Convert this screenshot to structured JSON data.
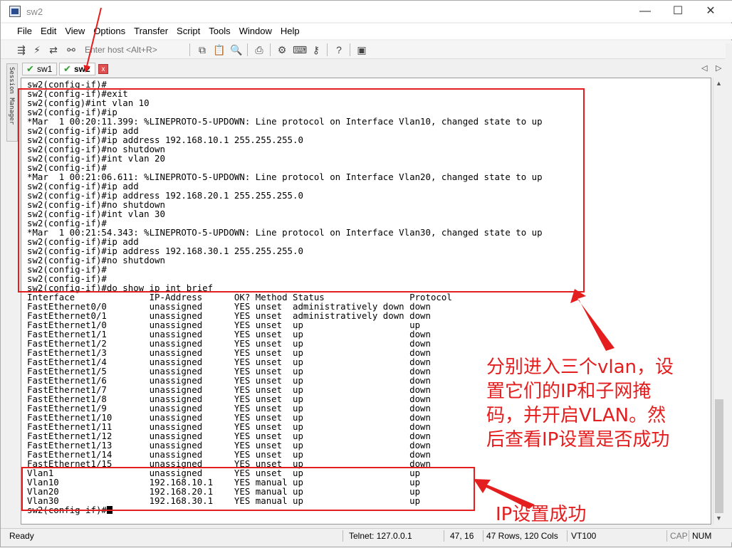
{
  "window": {
    "title": "sw2",
    "controls": {
      "minimize": "—",
      "maximize": "☐",
      "close": "✕"
    }
  },
  "menu": [
    "File",
    "Edit",
    "View",
    "Options",
    "Transfer",
    "Script",
    "Tools",
    "Window",
    "Help"
  ],
  "toolbar": {
    "host_placeholder": "Enter host <Alt+R>"
  },
  "session_manager": {
    "label": "Session Manager"
  },
  "tabs": [
    {
      "label": "sw1",
      "status": "connected"
    },
    {
      "label": "sw2",
      "status": "connected",
      "active": true
    }
  ],
  "terminal": {
    "lines": [
      "sw2(config-if)#",
      "sw2(config-if)#exit",
      "sw2(config)#int vlan 10",
      "sw2(config-if)#ip",
      "*Mar  1 00:20:11.399: %LINEPROTO-5-UPDOWN: Line protocol on Interface Vlan10, changed state to up",
      "sw2(config-if)#ip add",
      "sw2(config-if)#ip address 192.168.10.1 255.255.255.0",
      "sw2(config-if)#no shutdown",
      "sw2(config-if)#int vlan 20",
      "sw2(config-if)#",
      "*Mar  1 00:21:06.611: %LINEPROTO-5-UPDOWN: Line protocol on Interface Vlan20, changed state to up",
      "sw2(config-if)#ip add",
      "sw2(config-if)#ip address 192.168.20.1 255.255.255.0",
      "sw2(config-if)#no shutdown",
      "sw2(config-if)#int vlan 30",
      "sw2(config-if)#",
      "*Mar  1 00:21:54.343: %LINEPROTO-5-UPDOWN: Line protocol on Interface Vlan30, changed state to up",
      "sw2(config-if)#ip add",
      "sw2(config-if)#ip address 192.168.30.1 255.255.255.0",
      "sw2(config-if)#no shutdown",
      "sw2(config-if)#",
      "sw2(config-if)#",
      "sw2(config-if)#do show ip int brief",
      "Interface              IP-Address      OK? Method Status                Protocol",
      "FastEthernet0/0        unassigned      YES unset  administratively down down",
      "FastEthernet0/1        unassigned      YES unset  administratively down down",
      "FastEthernet1/0        unassigned      YES unset  up                    up",
      "FastEthernet1/1        unassigned      YES unset  up                    down",
      "FastEthernet1/2        unassigned      YES unset  up                    down",
      "FastEthernet1/3        unassigned      YES unset  up                    down",
      "FastEthernet1/4        unassigned      YES unset  up                    down",
      "FastEthernet1/5        unassigned      YES unset  up                    down",
      "FastEthernet1/6        unassigned      YES unset  up                    down",
      "FastEthernet1/7        unassigned      YES unset  up                    down",
      "FastEthernet1/8        unassigned      YES unset  up                    down",
      "FastEthernet1/9        unassigned      YES unset  up                    down",
      "FastEthernet1/10       unassigned      YES unset  up                    down",
      "FastEthernet1/11       unassigned      YES unset  up                    down",
      "FastEthernet1/12       unassigned      YES unset  up                    down",
      "FastEthernet1/13       unassigned      YES unset  up                    down",
      "FastEthernet1/14       unassigned      YES unset  up                    down",
      "FastEthernet1/15       unassigned      YES unset  up                    down",
      "Vlan1                  unassigned      YES unset  up                    up",
      "Vlan10                 192.168.10.1    YES manual up                    up",
      "Vlan20                 192.168.20.1    YES manual up                    up",
      "Vlan30                 192.168.30.1    YES manual up                    up"
    ],
    "prompt": "sw2(config-if)#"
  },
  "annotations": {
    "main_note": "分别进入三个vlan，设\n置它们的IP和子网掩\n码，并开启VLAN。然\n后查看IP设置是否成功",
    "success_note": "IP设置成功",
    "color": "#e41e1e"
  },
  "status": {
    "ready": "Ready",
    "connection": "Telnet: 127.0.0.1",
    "cursor_pos": "47, 16",
    "dimensions": "47 Rows, 120 Cols",
    "terminal_type": "VT100",
    "cap": "CAP",
    "num": "NUM"
  }
}
